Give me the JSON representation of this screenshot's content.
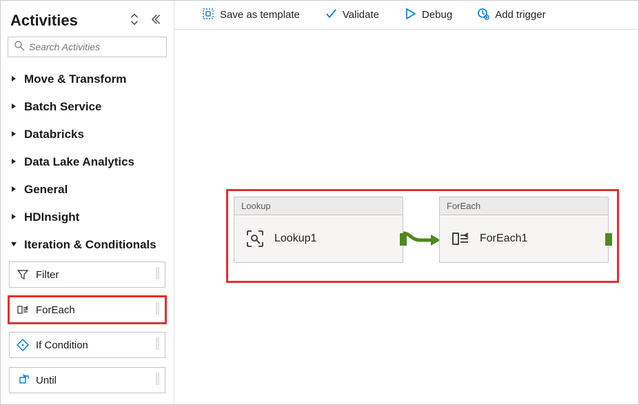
{
  "sidebar": {
    "title": "Activities",
    "search_placeholder": "Search Activities",
    "categories": [
      {
        "label": "Move & Transform",
        "expanded": false
      },
      {
        "label": "Batch Service",
        "expanded": false
      },
      {
        "label": "Databricks",
        "expanded": false
      },
      {
        "label": "Data Lake Analytics",
        "expanded": false
      },
      {
        "label": "General",
        "expanded": false
      },
      {
        "label": "HDInsight",
        "expanded": false
      },
      {
        "label": "Iteration & Conditionals",
        "expanded": true,
        "items": [
          {
            "label": "Filter",
            "icon": "filter-icon",
            "highlighted": false
          },
          {
            "label": "ForEach",
            "icon": "foreach-icon",
            "highlighted": true
          },
          {
            "label": "If Condition",
            "icon": "condition-icon",
            "highlighted": false
          },
          {
            "label": "Until",
            "icon": "until-icon",
            "highlighted": false
          }
        ]
      }
    ]
  },
  "toolbar": {
    "save_template_label": "Save as template",
    "validate_label": "Validate",
    "debug_label": "Debug",
    "add_trigger_label": "Add trigger"
  },
  "canvas": {
    "nodes": {
      "lookup": {
        "type": "Lookup",
        "name": "Lookup1"
      },
      "foreach": {
        "type": "ForEach",
        "name": "ForEach1"
      }
    }
  },
  "colors": {
    "accent_red": "#e3302e",
    "arrow_green": "#4e8a1f",
    "toolbar_blue": "#0078d4"
  }
}
